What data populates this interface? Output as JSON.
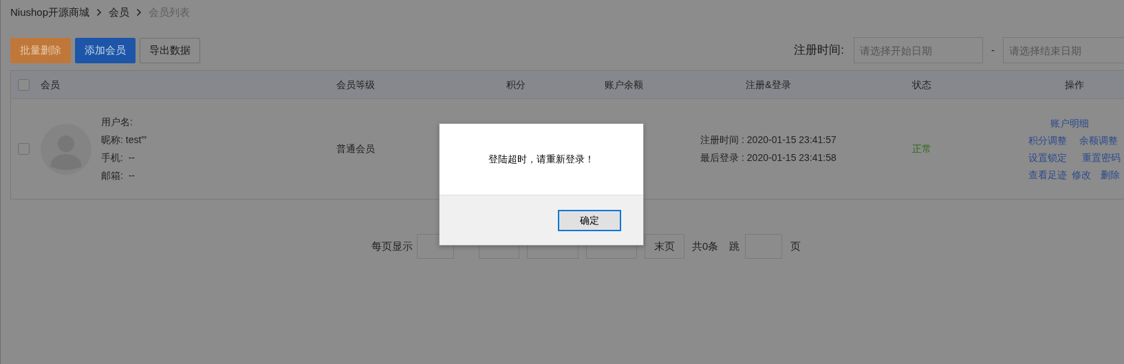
{
  "breadcrumb": [
    {
      "label": "Niushop开源商城",
      "current": false
    },
    {
      "label": "会员",
      "current": false
    },
    {
      "label": "会员列表",
      "current": true
    }
  ],
  "toolbar": {
    "buttons": [
      {
        "label": "批量删除",
        "kind": "danger"
      },
      {
        "label": "添加会员",
        "kind": "primary"
      },
      {
        "label": "导出数据",
        "kind": "default"
      }
    ]
  },
  "date_filter": {
    "label": "注册时间:",
    "start_placeholder": "请选择开始日期",
    "separator": "-",
    "end_placeholder": "请选择结束日期"
  },
  "table": {
    "select_all": {
      "checked": false
    },
    "columns": [
      "会员",
      "会员等级",
      "积分",
      "账户余额",
      "注册&登录",
      "状态",
      "操作"
    ],
    "rows": [
      {
        "checked": false,
        "username": "用户名:",
        "nickname": "昵称: test'\"",
        "phone": "手机:  --",
        "email": "邮箱:  --",
        "level": "普通会员",
        "registered": "注册时间 : 2020-01-15 23:41:57",
        "last_login": "最后登录 : 2020-01-15 23:41:58",
        "status": "正常",
        "action_lines": [
          {
            "items": [
              "账户明细"
            ]
          },
          {
            "items": [
              "积分调整",
              "余额调整"
            ]
          },
          {
            "items": [
              "设置锁定",
              "重置密码"
            ]
          },
          {
            "items": [
              "查看足迹",
              "修改",
              "删除"
            ]
          }
        ]
      }
    ]
  },
  "pagination": {
    "per_page_label": "每页显示",
    "buttons": [
      {
        "kind": "covered"
      },
      {
        "kind": "covered"
      },
      {
        "kind": "covered"
      },
      {
        "kind": "labeled",
        "label": "末页"
      }
    ],
    "total": "共0条",
    "jump_label": "跳",
    "jump_suffix": "页"
  },
  "dialog": {
    "message": "登陆超时，请重新登录！",
    "button": "确定"
  }
}
